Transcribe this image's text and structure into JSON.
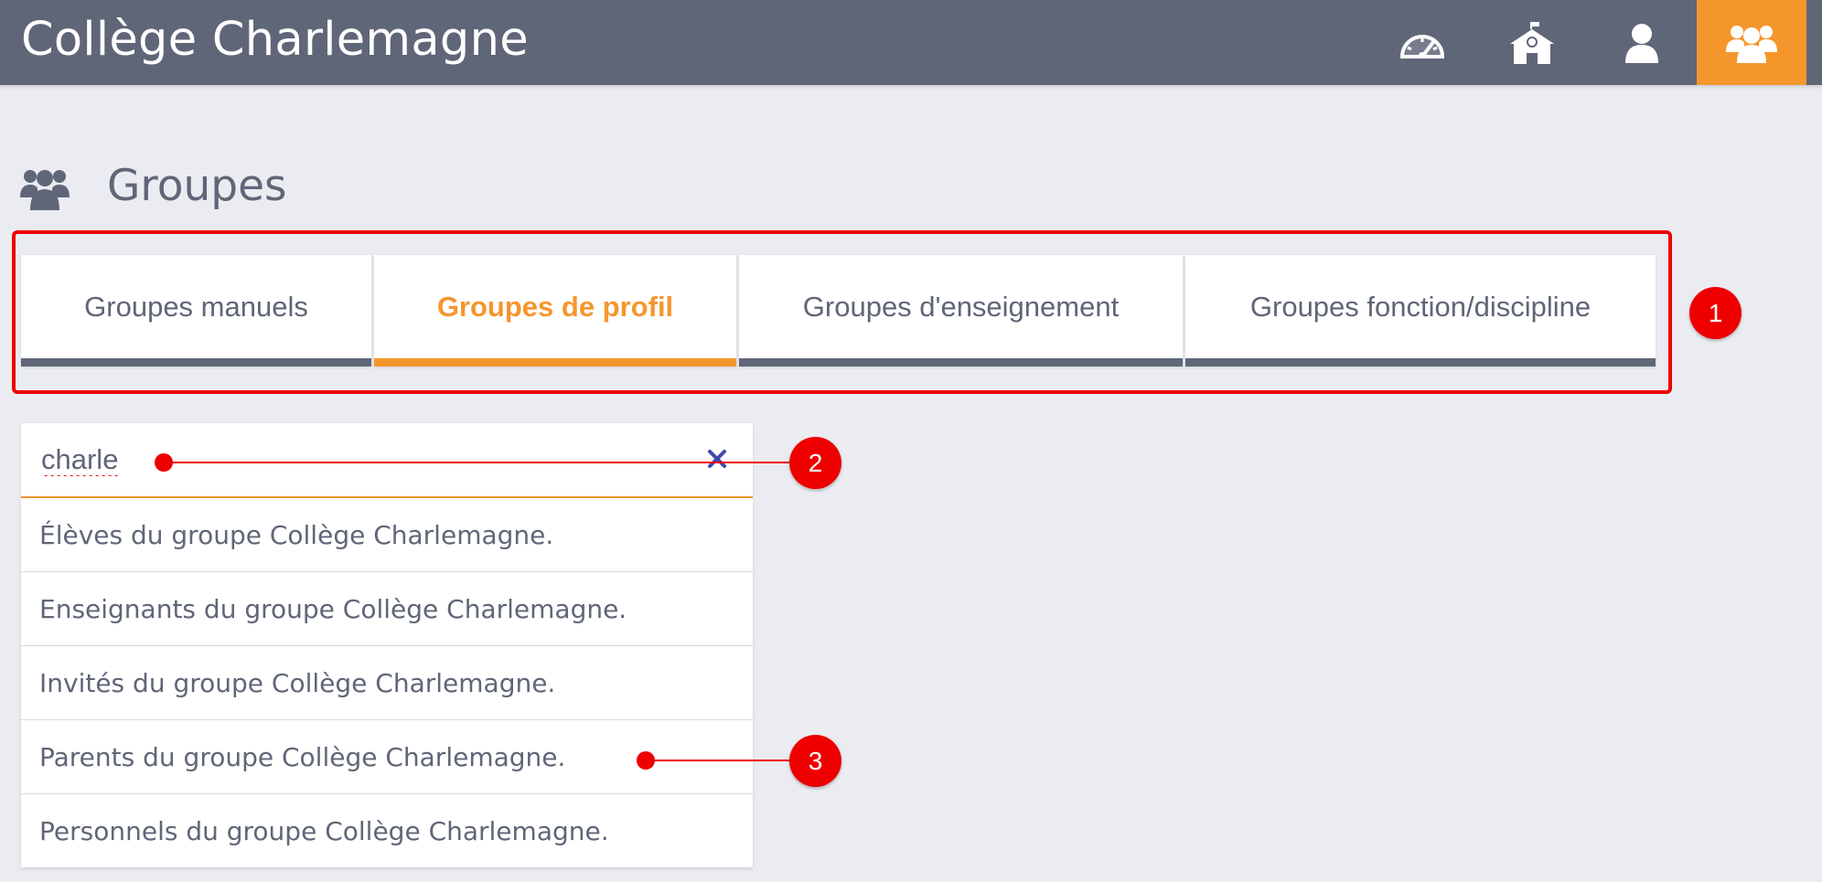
{
  "header": {
    "app_title": "Collège Charlemagne",
    "nav": [
      {
        "icon": "dashboard-gauge-icon"
      },
      {
        "icon": "school-building-icon"
      },
      {
        "icon": "user-icon"
      },
      {
        "icon": "groups-icon",
        "active": true
      }
    ]
  },
  "page": {
    "title": "Groupes",
    "title_icon": "users-group-icon"
  },
  "tabs": [
    {
      "label": "Groupes manuels",
      "active": false
    },
    {
      "label": "Groupes de profil",
      "active": true
    },
    {
      "label": "Groupes d'enseignement",
      "active": false
    },
    {
      "label": "Groupes fonction/discipline",
      "active": false
    }
  ],
  "search": {
    "value": "charle",
    "clear_icon": "close-icon"
  },
  "results": [
    "Élèves du groupe Collège Charlemagne.",
    "Enseignants du groupe Collège Charlemagne.",
    "Invités du groupe Collège Charlemagne.",
    "Parents du groupe Collège Charlemagne.",
    "Personnels du groupe Collège Charlemagne."
  ],
  "annotations": {
    "badge_1": "1",
    "badge_2": "2",
    "badge_3": "3"
  },
  "colors": {
    "header_bg": "#5f6677",
    "accent": "#f5962d",
    "page_bg": "#ebecf1",
    "annotation_red": "#ee0000"
  }
}
